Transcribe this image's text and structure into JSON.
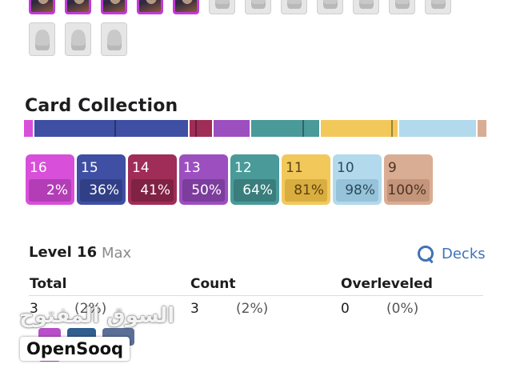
{
  "thumbnails_row1": [
    {
      "icon": "card-portrait-icon",
      "owned": true
    },
    {
      "icon": "card-portrait-icon",
      "owned": true
    },
    {
      "icon": "card-portrait-icon",
      "owned": true
    },
    {
      "icon": "card-portrait-icon",
      "owned": true
    },
    {
      "icon": "card-portrait-icon",
      "owned": true
    },
    {
      "icon": "locked-card-icon",
      "owned": false
    },
    {
      "icon": "locked-card-icon",
      "owned": false
    },
    {
      "icon": "locked-card-icon",
      "owned": false
    },
    {
      "icon": "locked-card-icon",
      "owned": false
    },
    {
      "icon": "locked-card-icon",
      "owned": false
    },
    {
      "icon": "locked-card-icon",
      "owned": false
    },
    {
      "icon": "locked-card-icon",
      "owned": false
    }
  ],
  "thumbnails_row2": [
    {
      "icon": "locked-card-icon",
      "owned": false
    },
    {
      "icon": "locked-card-icon",
      "owned": false
    },
    {
      "icon": "locked-card-icon",
      "owned": false
    }
  ],
  "collection": {
    "title": "Card Collection",
    "bar_segments": [
      {
        "level": "16",
        "share": 0.02,
        "color": "#d84fd9"
      },
      {
        "level": "15",
        "share": 0.34,
        "color": "#3f4fa3"
      },
      {
        "level": "14",
        "share": 0.05,
        "color": "#a02d57"
      },
      {
        "level": "13",
        "share": 0.08,
        "color": "#9c4fbf"
      },
      {
        "level": "12",
        "share": 0.15,
        "color": "#4a9a9a"
      },
      {
        "level": "11",
        "share": 0.17,
        "color": "#f2c85a"
      },
      {
        "level": "10",
        "share": 0.17,
        "color": "#b3d9ec"
      },
      {
        "level": "9",
        "share": 0.02,
        "color": "#d9ad93"
      }
    ],
    "tiles": [
      {
        "level": "16",
        "percent": "2%",
        "color": "#d84fd9",
        "dark": "#b23db6"
      },
      {
        "level": "15",
        "percent": "36%",
        "color": "#3f4fa3",
        "dark": "#313f86"
      },
      {
        "level": "14",
        "percent": "41%",
        "color": "#a02d57",
        "dark": "#7f2244"
      },
      {
        "level": "13",
        "percent": "50%",
        "color": "#9c4fbf",
        "dark": "#7c3d9c"
      },
      {
        "level": "12",
        "percent": "64%",
        "color": "#4a9a9a",
        "dark": "#3a7d7d"
      },
      {
        "level": "11",
        "percent": "81%",
        "color": "#f2c85a",
        "dark": "#d9ad3f",
        "text": "#5a4310"
      },
      {
        "level": "10",
        "percent": "98%",
        "color": "#b3d9ec",
        "dark": "#96c3d9",
        "text": "#2c4a5c"
      },
      {
        "level": "9",
        "percent": "100%",
        "color": "#d9ad93",
        "dark": "#c4957a",
        "text": "#4d3326"
      }
    ]
  },
  "level_panel": {
    "title": "Level 16",
    "subtitle": "Max",
    "decks_label": "Decks",
    "columns": [
      "Total",
      "Count",
      "Overleveled"
    ],
    "row": {
      "total": "3",
      "total_pct": "(2%)",
      "count": "3",
      "count_pct": "(2%)",
      "overleveled": "0",
      "overleveled_pct": "(0%)"
    }
  },
  "watermark": {
    "arabic": "السوق المفتوح",
    "brand": "OpenSooq"
  }
}
